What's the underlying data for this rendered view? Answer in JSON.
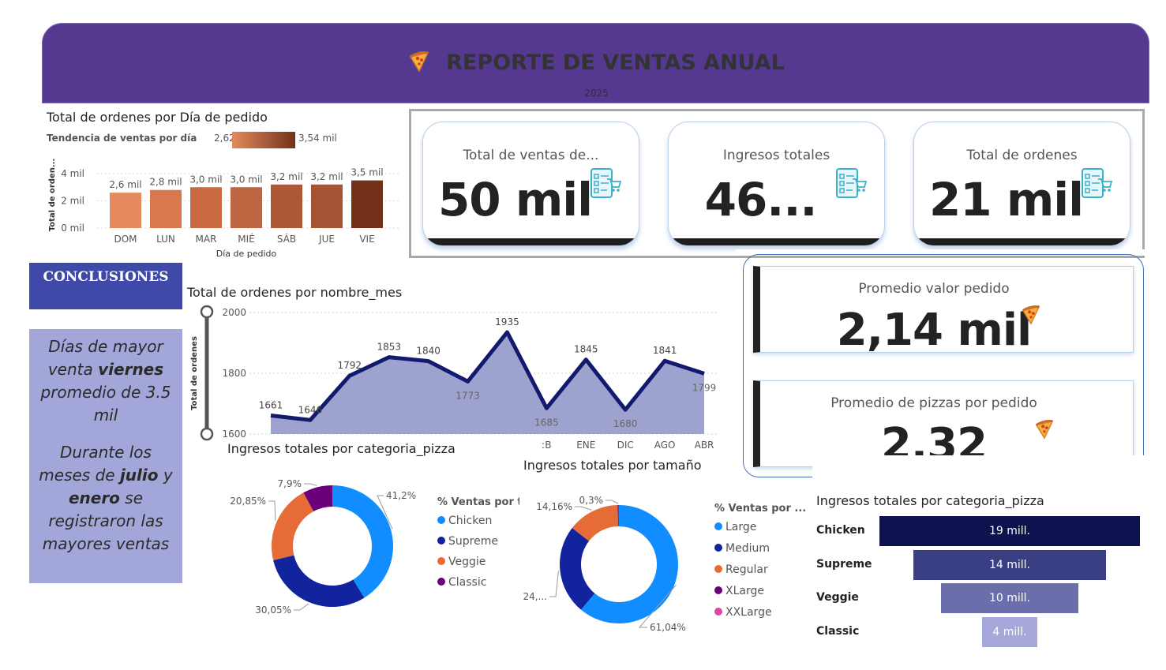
{
  "header": {
    "title": "REPORTE DE VENTAS ANUAL",
    "year": "2025",
    "icon": "pizza-icon",
    "bg_color": "#553990"
  },
  "day_chart": {
    "title": "Total de ordenes por Día de pedido",
    "legend_label": "Tendencia de ventas por día",
    "legend_min": "2,62 mil",
    "legend_max": "3,54 mil",
    "ylabel": "Total de orden...",
    "xlabel": "Día de pedido",
    "yticks": [
      "4 mil",
      "2 mil",
      "0 mil"
    ],
    "chart_data": {
      "type": "bar",
      "categories": [
        "DOM",
        "LUN",
        "MAR",
        "MIÉ",
        "SÁB",
        "JUE",
        "VIE"
      ],
      "values": [
        2.6,
        2.8,
        3.0,
        3.0,
        3.2,
        3.2,
        3.5
      ],
      "value_labels": [
        "2,6 mil",
        "2,8 mil",
        "3,0 mil",
        "3,0 mil",
        "3,2 mil",
        "3,2 mil",
        "3,5 mil"
      ],
      "colors": [
        "#e58a5d",
        "#d8784c",
        "#c96a41",
        "#bd6440",
        "#ac5837",
        "#a45434",
        "#73311a"
      ],
      "ylim": [
        0,
        4
      ]
    }
  },
  "kpis": [
    {
      "label": "Total de ventas de...",
      "value": "50 mil",
      "icon": "checklist-cart-icon"
    },
    {
      "label": "Ingresos totales",
      "value": "46...",
      "icon": "checklist-cart-icon"
    },
    {
      "label": "Total de ordenes",
      "value": "21 mil",
      "icon": "checklist-cart-icon"
    }
  ],
  "averages": [
    {
      "label": "Promedio valor pedido",
      "value": "2,14 mil",
      "icon": "pizza-icon"
    },
    {
      "label": "Promedio de pizzas por pedido",
      "value": "2,32",
      "icon": "pizza-icon"
    }
  ],
  "conclusions": {
    "title": "CONCLUSIONES",
    "p1_a": "Días de mayor venta ",
    "p1_b": "viernes",
    "p1_c": " promedio de 3.5 mil",
    "p2_a": "Durante los meses de ",
    "p2_b": "julio",
    "p2_c": " y ",
    "p2_d": "enero",
    "p2_e": " se registraron las mayores ventas"
  },
  "month_chart": {
    "title": "Total de ordenes por nombre_mes",
    "ylabel": "Total de ordenes",
    "yticks": [
      "2000",
      "1800",
      "1600"
    ],
    "visible_xticks": [
      "ːB",
      "ENE",
      "DIC",
      "AGO",
      "ABR"
    ],
    "chart_data": {
      "type": "area",
      "values": [
        1661,
        1646,
        1792,
        1853,
        1840,
        1773,
        1935,
        1685,
        1845,
        1680,
        1841,
        1799
      ],
      "labels": [
        "1661",
        "1646",
        "1792",
        "1853",
        "1840",
        "1773",
        "1935",
        "1685",
        "1845",
        "1680",
        "1841",
        "1799"
      ],
      "ylim": [
        1600,
        2000
      ],
      "line_color": "#121a6e",
      "fill_color": "#9ea2cf"
    }
  },
  "category_donut": {
    "title": "Ingresos totales por categoria_pizza",
    "legend_title": "% Ventas por t",
    "chart_data": {
      "type": "pie",
      "categories": [
        "Chicken",
        "Supreme",
        "Veggie",
        "Classic"
      ],
      "values": [
        41.2,
        30.05,
        20.85,
        7.9
      ],
      "labels": [
        "41,2%",
        "30,05%",
        "20,85%",
        "7,9%"
      ],
      "colors": [
        "#118dff",
        "#12239e",
        "#e66c37",
        "#6b007b"
      ]
    }
  },
  "size_donut": {
    "title": "Ingresos totales por tamaño",
    "legend_title": "% Ventas por ...",
    "chart_data": {
      "type": "pie",
      "categories": [
        "Large",
        "Medium",
        "Regular",
        "XLarge",
        "XXLarge"
      ],
      "values": [
        61.04,
        24.46,
        14.16,
        0.3,
        0.04
      ],
      "labels": [
        "61,04%",
        "24,...",
        "14,16%",
        "0,3%",
        ""
      ],
      "colors": [
        "#118dff",
        "#12239e",
        "#e66c37",
        "#6b007b",
        "#e044a7"
      ]
    }
  },
  "funnel": {
    "title": "Ingresos totales por categoria_pizza",
    "chart_data": {
      "type": "bar",
      "categories": [
        "Chicken",
        "Supreme",
        "Veggie",
        "Classic"
      ],
      "values": [
        19,
        14,
        10,
        4
      ],
      "labels": [
        "19 mill.",
        "14 mill.",
        "10 mill.",
        "4 mill."
      ],
      "colors": [
        "#0e124e",
        "#3a3f84",
        "#6a6eab",
        "#a5a8d9"
      ]
    }
  }
}
